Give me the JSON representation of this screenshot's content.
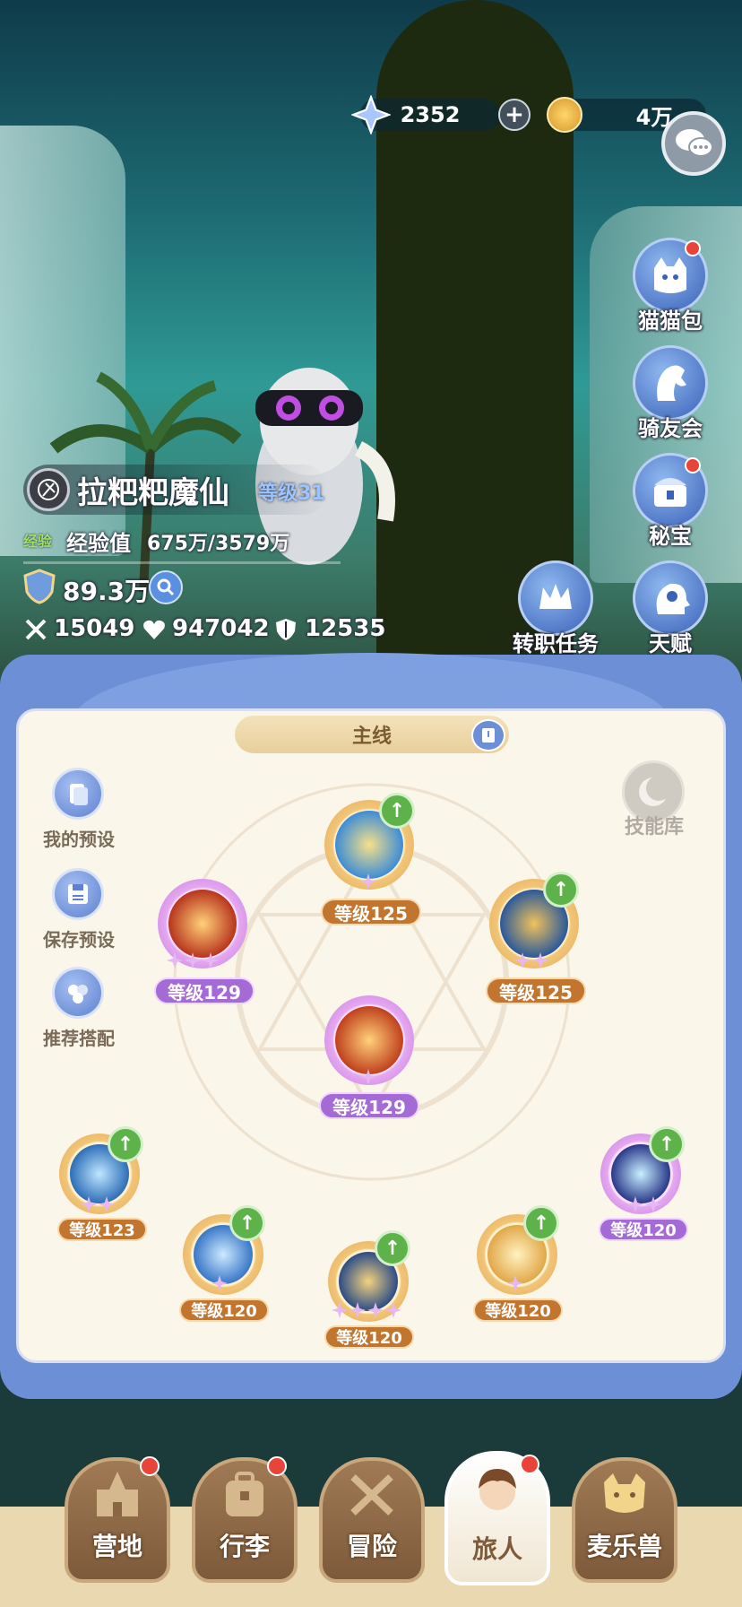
{
  "currencies": {
    "gems": "2352",
    "gold": "4万"
  },
  "right_menu": {
    "cat_bag": "猫猫包",
    "rider_club": "骑友会",
    "treasure": "秘宝",
    "job_quest": "转职任务",
    "talent": "天赋"
  },
  "player": {
    "name": "拉粑粑魔仙",
    "level": "等级31",
    "exp_tag": "经验",
    "exp_label": "经验值",
    "exp_value": "675万/3579万",
    "power": "89.3万",
    "attack": "15049",
    "hp": "947042",
    "defense": "12535"
  },
  "panel": {
    "mode": "主线",
    "skill_library": "技能库",
    "my_preset": "我的预设",
    "save_preset": "保存预设",
    "recommended": "推荐搭配"
  },
  "skills": [
    {
      "level": "等级125",
      "frame": "orange",
      "upgradable": true,
      "stars": 1
    },
    {
      "level": "等级129",
      "frame": "purple",
      "upgradable": false,
      "stars": 3
    },
    {
      "level": "等级125",
      "frame": "orange",
      "upgradable": true,
      "stars": 2
    },
    {
      "level": "等级129",
      "frame": "purple",
      "upgradable": false,
      "stars": 1
    },
    {
      "level": "等级123",
      "frame": "orange",
      "upgradable": true,
      "stars": 2
    },
    {
      "level": "等级120",
      "frame": "orange",
      "upgradable": true,
      "stars": 1
    },
    {
      "level": "等级120",
      "frame": "orange",
      "upgradable": true,
      "stars": 4
    },
    {
      "level": "等级120",
      "frame": "orange",
      "upgradable": true,
      "stars": 1
    },
    {
      "level": "等级120",
      "frame": "purple",
      "upgradable": true,
      "stars": 2
    }
  ],
  "bottom_nav": {
    "camp": "营地",
    "luggage": "行李",
    "adventure": "冒险",
    "traveler": "旅人",
    "pets": "麦乐兽"
  },
  "colors": {
    "panel_blue": "#6c8fd6",
    "level_orange": "#c2752f",
    "level_purple": "#a46ad6",
    "upgrade_green": "#5db24a"
  }
}
